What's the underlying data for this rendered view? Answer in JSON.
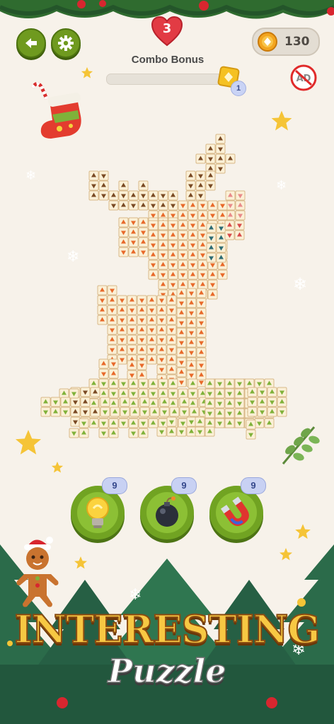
{
  "hud": {
    "lives": "3",
    "coins": "130",
    "combo_label": "Combo Bonus",
    "combo_progress": 0.0,
    "combo_level": "1",
    "no_ads_label": "AD"
  },
  "tools": [
    {
      "name": "hint",
      "count": "9",
      "icon": "lightbulb-icon"
    },
    {
      "name": "bomb",
      "count": "9",
      "icon": "bomb-icon"
    },
    {
      "name": "magnet",
      "count": "9",
      "icon": "magnet-icon"
    }
  ],
  "banner": {
    "line1": "INTERESTING",
    "line2": "Puzzle"
  },
  "board": {
    "shape": "reindeer",
    "tile_colors": {
      "face": "#fbf0d6",
      "edge": "#d8b98a",
      "brown": "#7a4a24",
      "orange": "#e8692a",
      "green": "#7fb23a",
      "red": "#d84a4a",
      "teal": "#2d6b73",
      "pink": "#e98a8a"
    }
  },
  "colors": {
    "primary_green": "#6f9a1f",
    "accent_gold": "#f7c843",
    "heart_red": "#e23b44"
  }
}
